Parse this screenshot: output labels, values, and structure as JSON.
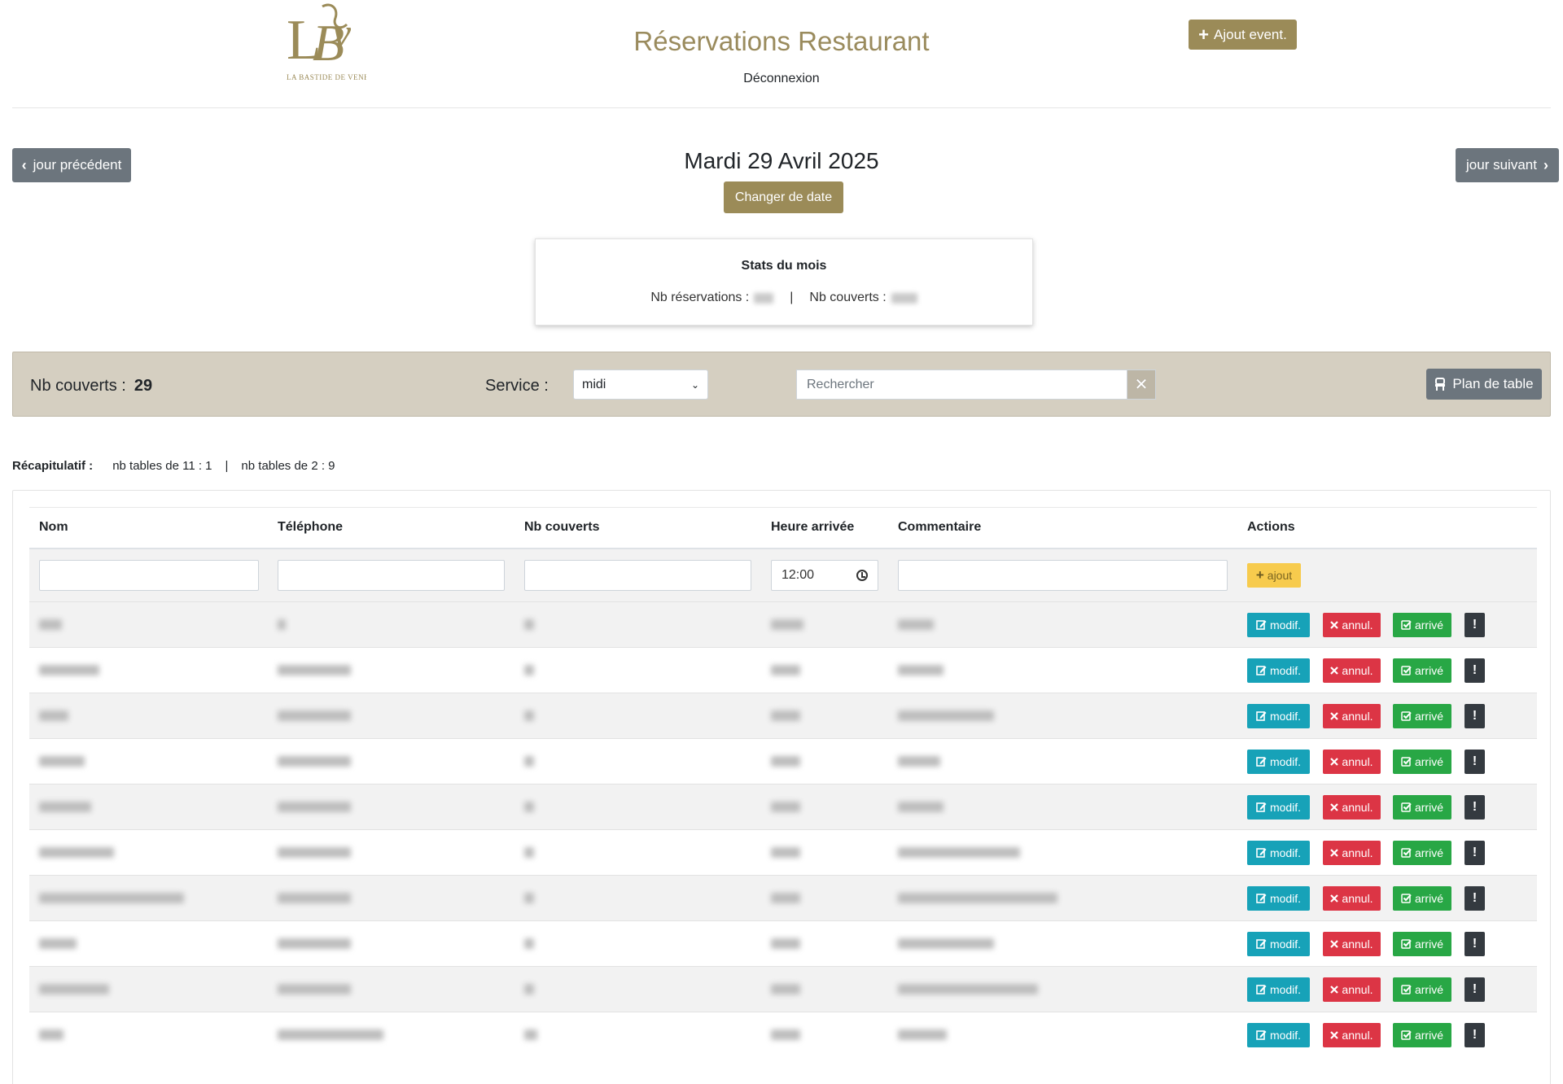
{
  "header": {
    "logo_alt": "LBV LA BASTIDE DE VENELLES",
    "title": "Réservations Restaurant",
    "logout_label": "Déconnexion",
    "add_event_label": "Ajout event."
  },
  "date_nav": {
    "prev_label": "jour précédent",
    "next_label": "jour suivant",
    "current_date": "Mardi 29 Avril 2025",
    "change_date_label": "Changer de date"
  },
  "stats": {
    "title": "Stats du mois",
    "reservations_label": "Nb réservations :",
    "separator": "|",
    "covers_label": "Nb couverts :"
  },
  "service_bar": {
    "covers_label": "Nb couverts :",
    "covers_value": "29",
    "service_label": "Service :",
    "service_selected": "midi",
    "search_placeholder": "Rechercher",
    "table_plan_label": "Plan de table"
  },
  "recap": {
    "label": "Récapitulatif :",
    "item1": "nb tables de 11 : 1",
    "separator": "|",
    "item2": "nb tables de 2 : 9"
  },
  "table": {
    "columns": [
      "Nom",
      "Téléphone",
      "Nb couverts",
      "Heure arrivée",
      "Commentaire",
      "Actions"
    ],
    "new_row": {
      "time_value": "12:00",
      "add_label": "ajout"
    },
    "action_labels": {
      "modif": "modif.",
      "annul": "annul.",
      "arrive": "arrivé",
      "alert": "!"
    },
    "row_count": 10
  },
  "colors": {
    "brand": "#9b8b58",
    "title": "#9a8b5d",
    "bar_bg": "#d5cfc1",
    "modif": "#17a2b8",
    "annul": "#dc3545",
    "arrive": "#28a745",
    "alert": "#343a40",
    "add": "#f7cb4d"
  }
}
